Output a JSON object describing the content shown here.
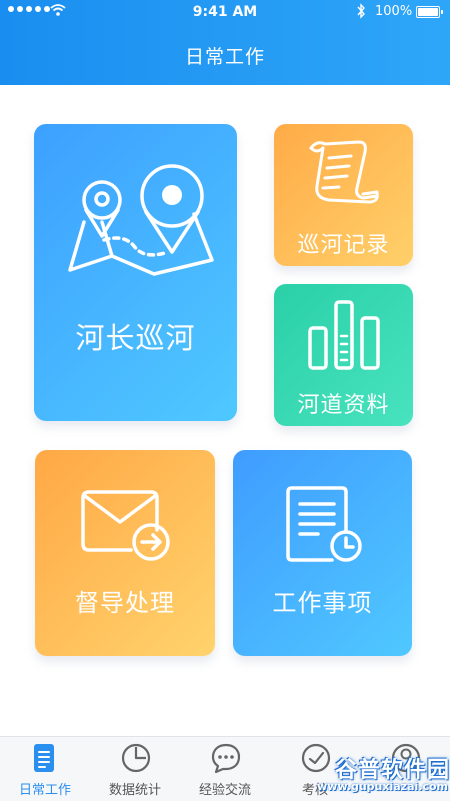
{
  "status_bar": {
    "time": "9:41 AM",
    "battery": "100%",
    "icons": [
      "signal-dots-icon",
      "wifi-icon",
      "bluetooth-icon",
      "battery-icon"
    ]
  },
  "header": {
    "title": "日常工作",
    "gradient": [
      "#1a8ef0",
      "#2ea6f8"
    ]
  },
  "tiles": [
    {
      "label": "河长巡河",
      "icon": "map-pin-route-icon",
      "colors": [
        "#3da0ff",
        "#4fc8ff"
      ]
    },
    {
      "label": "巡河记录",
      "icon": "scroll-document-icon",
      "colors": [
        "#ffab47",
        "#ffd06a"
      ]
    },
    {
      "label": "河道资料",
      "icon": "bar-chart-icon",
      "colors": [
        "#2ad0a7",
        "#48e3bf"
      ]
    },
    {
      "label": "督导处理",
      "icon": "mail-forward-icon",
      "colors": [
        "#ffa845",
        "#ffd36d"
      ]
    },
    {
      "label": "工作事项",
      "icon": "document-clock-icon",
      "colors": [
        "#3f9cff",
        "#50c8ff"
      ]
    }
  ],
  "tabbar": {
    "active_color": "#2b8ff0",
    "items": [
      {
        "label": "日常工作",
        "icon": "document-icon",
        "active": true
      },
      {
        "label": "数据统计",
        "icon": "pie-clock-icon",
        "active": false
      },
      {
        "label": "经验交流",
        "icon": "chat-bubble-icon",
        "active": false
      },
      {
        "label": "考核",
        "icon": "check-circle-icon",
        "active": false
      },
      {
        "label": "",
        "icon": "user-icon",
        "active": false
      }
    ]
  },
  "watermark": {
    "text": "谷普软件园",
    "url": "www.gupuxiazai.com"
  }
}
